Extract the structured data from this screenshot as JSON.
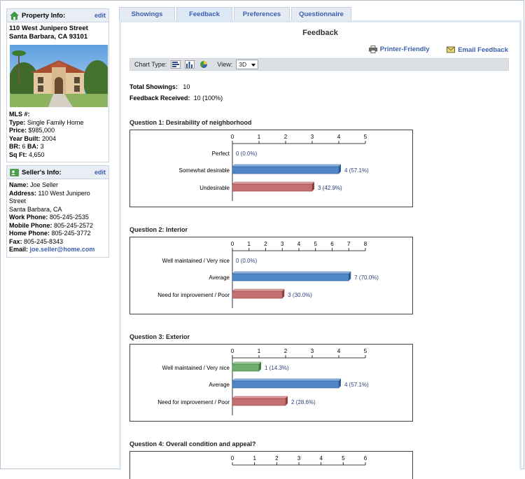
{
  "property": {
    "header": "Property Info:",
    "edit": "edit",
    "address_line1": "110 West Junipero Street",
    "address_line2": "Santa Barbara, CA 93101",
    "mls_label": "MLS #:",
    "mls_value": "",
    "type_label": "Type:",
    "type_value": "Single Family Home",
    "price_label": "Price:",
    "price_value": "$985,000",
    "year_label": "Year Built:",
    "year_value": "2004",
    "br_label": "BR:",
    "br_value": "6",
    "ba_label": "BA:",
    "ba_value": "3",
    "sqft_label": "Sq Ft:",
    "sqft_value": "4,650"
  },
  "seller": {
    "header": "Seller's Info:",
    "edit": "edit",
    "name_label": "Name:",
    "name_value": "Joe Seller",
    "address_label": "Address:",
    "address_value": "110 West Junipero Street",
    "city": "Santa Barbara, CA",
    "work_label": "Work Phone:",
    "work_value": "805-245-2535",
    "mobile_label": "Mobile Phone:",
    "mobile_value": "805-245-2572",
    "home_label": "Home Phone:",
    "home_value": "805-245-3772",
    "fax_label": "Fax:",
    "fax_value": "805-245-8343",
    "email_label": "Email:",
    "email_value": "joe.seller@home.com"
  },
  "tabs": [
    "Showings",
    "Feedback",
    "Preferences",
    "Questionnaire"
  ],
  "active_tab": 1,
  "panel": {
    "title": "Feedback",
    "printer": "Printer-Friendly",
    "email": "Email Feedback",
    "chart_type_label": "Chart Type:",
    "view_label": "View:",
    "view_value": "3D",
    "total_showings_label": "Total Showings:",
    "total_showings_value": "10",
    "feedback_label": "Feedback Received:",
    "feedback_value": "10 (100%)"
  },
  "colors": {
    "blue": "#4f86c6",
    "red": "#c47070",
    "green": "#6fae6f",
    "link": "#3b5fb0"
  },
  "chart_data": [
    {
      "type": "bar",
      "title": "Question 1: Desirability of neighborhood",
      "categories": [
        "Perfect",
        "Somewhat desirable",
        "Undesirable"
      ],
      "values": [
        0,
        4,
        3
      ],
      "labels": [
        "0 (0.0%)",
        "4 (57.1%)",
        "3 (42.9%)"
      ],
      "colors": [
        "blue",
        "blue",
        "red"
      ],
      "xlim": [
        0,
        5
      ],
      "ticks": [
        0,
        1,
        2,
        3,
        4,
        5
      ]
    },
    {
      "type": "bar",
      "title": "Question 2: Interior",
      "categories": [
        "Well maintained / Very nice",
        "Average",
        "Need for improvement / Poor"
      ],
      "values": [
        0,
        7,
        3
      ],
      "labels": [
        "0 (0.0%)",
        "7 (70.0%)",
        "3 (30.0%)"
      ],
      "colors": [
        "blue",
        "blue",
        "red"
      ],
      "xlim": [
        0,
        8
      ],
      "ticks": [
        0,
        1,
        2,
        3,
        4,
        5,
        6,
        7,
        8
      ]
    },
    {
      "type": "bar",
      "title": "Question 3: Exterior",
      "categories": [
        "Well maintained / Very nice",
        "Average",
        "Need for improvement / Poor"
      ],
      "values": [
        1,
        4,
        2
      ],
      "labels": [
        "1 (14.3%)",
        "4 (57.1%)",
        "2 (28.6%)"
      ],
      "colors": [
        "green",
        "blue",
        "red"
      ],
      "xlim": [
        0,
        5
      ],
      "ticks": [
        0,
        1,
        2,
        3,
        4,
        5
      ]
    },
    {
      "type": "bar",
      "title": "Question 4: Overall condition and appeal?",
      "categories": [],
      "values": [],
      "labels": [],
      "colors": [],
      "xlim": [
        0,
        6
      ],
      "ticks": [
        0,
        1,
        2,
        3,
        4,
        5,
        6
      ]
    }
  ]
}
